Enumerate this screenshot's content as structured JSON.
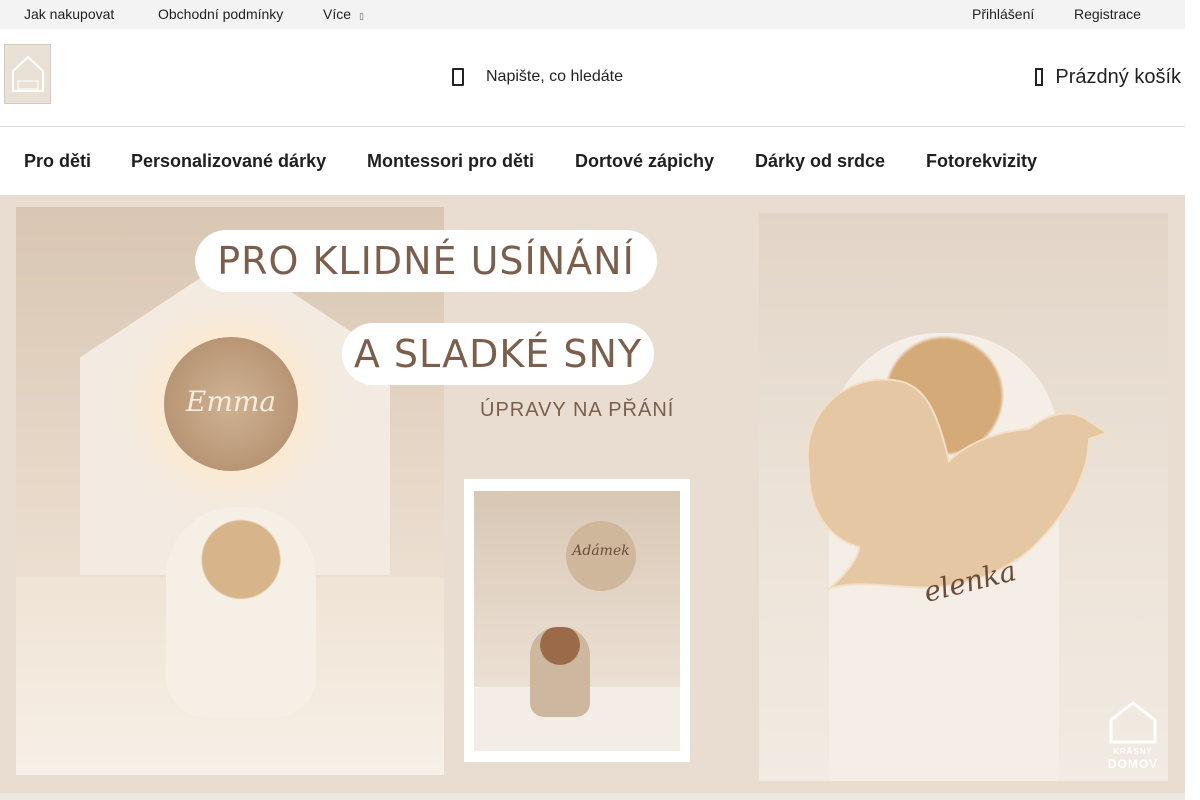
{
  "topbar": {
    "links": [
      "Jak nakupovat",
      "Obchodní podmínky",
      "Více"
    ],
    "login": "Přihlášení",
    "register": "Registrace"
  },
  "header": {
    "logo_name": "home-logo",
    "search_placeholder": "Napište, co hledáte",
    "cart_label": "Prázdný košík"
  },
  "nav": {
    "items": [
      "Pro děti",
      "Personalizované dárky",
      "Montessori pro děti",
      "Dortové zápichy",
      "Dárky od srdce",
      "Fotorekvizity"
    ]
  },
  "banner": {
    "headline_1": "PRO KLIDNÉ USÍNÁNÍ",
    "headline_2": "A SLADKÉ SNY",
    "subtitle": "ÚPRAVY NA PŘÁNÍ",
    "lamp_name": "Emma",
    "mini_lamp_name": "Adámek",
    "dove_name": "elenka",
    "watermark_line1": "KRÁSNÝ",
    "watermark_line2": "DOMOV"
  },
  "colors": {
    "brand_text": "#7b5f4c",
    "banner_bg": "#e9ddd2",
    "topbar_bg": "#f3f3f3"
  }
}
